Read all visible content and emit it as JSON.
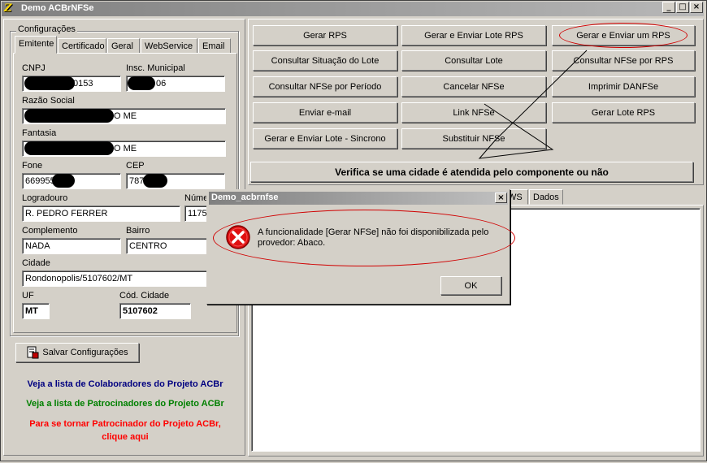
{
  "window": {
    "title": "Demo ACBrNFSe",
    "app_icon": "app-logo-icon",
    "controls": {
      "minimize": "_",
      "maximize": "□",
      "close": "×"
    }
  },
  "config": {
    "group_label": "Configurações",
    "tabs": [
      "Emitente",
      "Certificado",
      "Geral",
      "WebService",
      "Email"
    ],
    "active_tab": "Emitente",
    "fields": {
      "cnpj": {
        "label": "CNPJ",
        "value": "0153"
      },
      "insc_municipal": {
        "label": "Insc. Municipal",
        "value": "06"
      },
      "razao_social": {
        "label": "Razão Social",
        "value": "O ME"
      },
      "fantasia": {
        "label": "Fantasia",
        "value": "O ME"
      },
      "fone": {
        "label": "Fone",
        "value": "669955"
      },
      "cep": {
        "label": "CEP",
        "value": "787"
      },
      "logradouro": {
        "label": "Logradouro",
        "value": "R. PEDRO FERRER"
      },
      "numero": {
        "label": "Núme",
        "value": "1175"
      },
      "complemento": {
        "label": "Complemento",
        "value": "NADA"
      },
      "bairro": {
        "label": "Bairro",
        "value": "CENTRO"
      },
      "cidade": {
        "label": "Cidade",
        "value": "Rondonopolis/5107602/MT"
      },
      "uf": {
        "label": "UF",
        "value": "MT"
      },
      "cod_cidade": {
        "label": "Cód. Cidade",
        "value": "5107602"
      }
    },
    "save_button": "Salvar Configurações",
    "save_icon": "save-config-icon"
  },
  "links": {
    "colaboradores": "Veja a lista de Colaboradores do Projeto ACBr",
    "patrocinadores": "Veja a lista de Patrocinadores do Projeto ACBr",
    "tornar_patrocinador_1": "Para se tornar Patrocinador do Projeto ACBr,",
    "tornar_patrocinador_2": "clique aqui",
    "colors": {
      "colaboradores": "#000080",
      "patrocinadores": "#008000",
      "tornar": "#ff0000"
    }
  },
  "actions": {
    "gerar_rps": "Gerar RPS",
    "gerar_enviar_lote_rps": "Gerar e Enviar Lote RPS",
    "gerar_enviar_um_rps": "Gerar e Enviar um RPS",
    "consultar_situacao_lote": "Consultar Situação do Lote",
    "consultar_lote": "Consultar Lote",
    "consultar_nfse_rps": "Consultar NFSe por RPS",
    "consultar_nfse_periodo": "Consultar NFSe por Período",
    "cancelar_nfse": "Cancelar NFSe",
    "imprimir_danfse": "Imprimir DANFSe",
    "enviar_email": "Enviar e-mail",
    "link_nfse": "Link NFSe",
    "gerar_lote_rps": "Gerar Lote RPS",
    "gerar_enviar_lote_sincrono": "Gerar e Enviar Lote - Sincrono",
    "substituir_nfse": "Substituir NFSe",
    "verifica_cidade": "Verifica se uma cidade é atendida pelo componente ou não"
  },
  "result_tabs": [
    "WS",
    "Dados"
  ],
  "dialog": {
    "title": "Demo_acbrnfse",
    "close": "×",
    "icon": "error-icon",
    "message_line1": "A funcionalidade [Gerar NFSe] não foi disponibilizada pelo",
    "message_line2": "provedor: Abaco.",
    "ok_button": "OK"
  },
  "annotation_color": "#d00000"
}
